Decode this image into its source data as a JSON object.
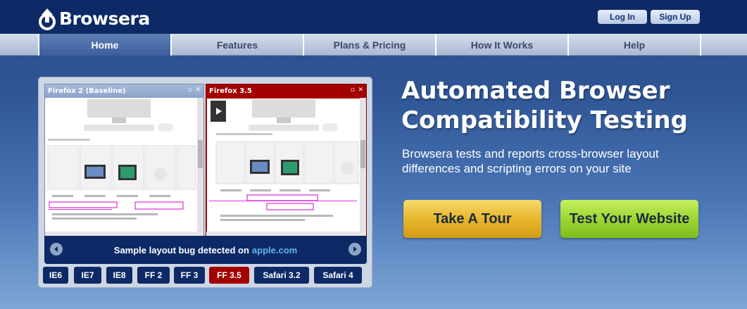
{
  "brand": {
    "name": "Browsera"
  },
  "auth": {
    "login": "Log In",
    "signup": "Sign Up"
  },
  "nav": {
    "items": [
      {
        "label": "Home",
        "active": true
      },
      {
        "label": "Features",
        "active": false
      },
      {
        "label": "Plans & Pricing",
        "active": false
      },
      {
        "label": "How It Works",
        "active": false
      },
      {
        "label": "Help",
        "active": false
      }
    ]
  },
  "showcase": {
    "left_pane_title": "Firefox 2 (Baseline)",
    "right_pane_title": "Firefox 3.5",
    "caption": "Sample layout bug detected on",
    "caption_link": "apple.com",
    "browsers": [
      {
        "label": "IE6",
        "active": false
      },
      {
        "label": "IE7",
        "active": false
      },
      {
        "label": "IE8",
        "active": false
      },
      {
        "label": "FF 2",
        "active": false
      },
      {
        "label": "FF 3",
        "active": false
      },
      {
        "label": "FF 3.5",
        "active": true
      },
      {
        "label": "Safari 3.2",
        "active": false
      },
      {
        "label": "Safari 4",
        "active": false
      }
    ]
  },
  "hero": {
    "headline_line1": "Automated Browser",
    "headline_line2": "Compatibility Testing",
    "subtext": "Browsera tests and reports cross-browser layout differences and scripting errors on your site"
  },
  "cta": {
    "tour": "Take A Tour",
    "test": "Test Your Website"
  },
  "colors": {
    "header_bg": "#0d2a66",
    "active_browser": "#a30000",
    "highlight": "#d500d5",
    "link": "#5fb4ea"
  }
}
